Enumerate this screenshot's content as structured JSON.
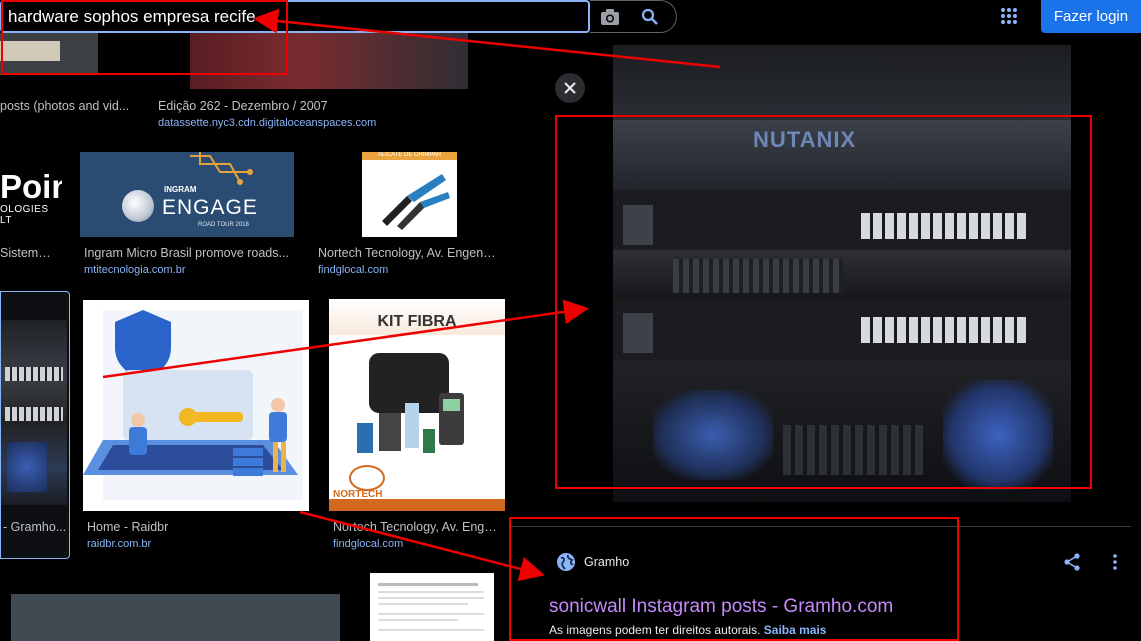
{
  "search": {
    "value": "hardware sophos empresa recife"
  },
  "header": {
    "login_label": "Fazer login"
  },
  "results": [
    {
      "title": "posts (photos and vid...",
      "domain": ""
    },
    {
      "title": "Edição 262 - Dezembro / 2007",
      "domain": "datassette.nyc3.cdn.digitaloceanspaces.com"
    },
    {
      "title": "Sistema ...",
      "domain": "",
      "logo_text": "Poin",
      "logo_sub": "OLOGIES LT"
    },
    {
      "title": "Ingram Micro Brasil promove roads...",
      "domain": "mtitecnologia.com.br",
      "brand": "INGRAM",
      "brand_big": "ENGAGE",
      "brand_small": "ROAD TOUR 2018"
    },
    {
      "title": "Nortech Tecnology, Av. Engenh...",
      "domain": "findglocal.com",
      "thumb_text": "ALICATE DE CRIMPAR"
    },
    {
      "title": "- Gramho...",
      "domain": ""
    },
    {
      "title": "Home - Raidbr",
      "domain": "raidbr.com.br"
    },
    {
      "title": "Nortech Tecnology, Av. Enge...",
      "domain": "findglocal.com",
      "thumb_title": "KIT FIBRA",
      "thumb_logo": "NORTECH"
    }
  ],
  "preview": {
    "brand_on_image": "NUTANIX",
    "source": "Gramho",
    "title": "sonicwall Instagram posts - Gramho.com",
    "rights_text": "As imagens podem ter direitos autorais.",
    "learn_more": "Saiba mais"
  },
  "colors": {
    "accent": "#8ab4f8",
    "annotation": "#ee0000",
    "title_link": "#c58af9",
    "button": "#1a73e8"
  }
}
